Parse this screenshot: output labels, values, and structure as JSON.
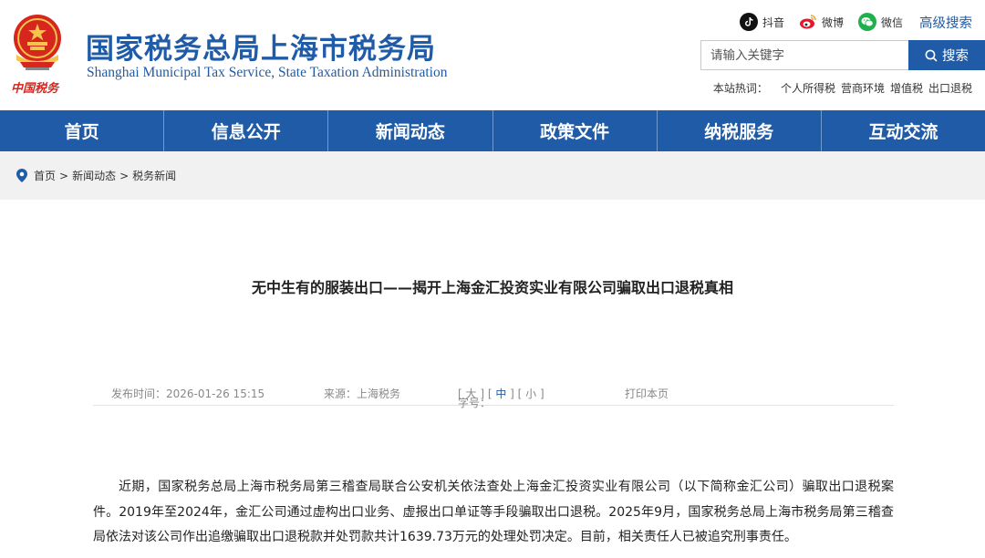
{
  "header": {
    "title_cn": "国家税务总局上海市税务局",
    "title_en": "Shanghai Municipal Tax Service, State Taxation Administration",
    "logo_caption": "中国税务",
    "social": [
      {
        "label": "抖音",
        "icon": "douyin-icon"
      },
      {
        "label": "微博",
        "icon": "weibo-icon"
      },
      {
        "label": "微信",
        "icon": "wechat-icon"
      }
    ],
    "advanced_search": "高级搜索",
    "search_placeholder": "请输入关键字",
    "search_button": "搜索",
    "hot_label": "本站热词：",
    "hot_words": [
      "个人所得税",
      "营商环境",
      "增值税",
      "出口退税"
    ]
  },
  "nav": {
    "items": [
      "首页",
      "信息公开",
      "新闻动态",
      "政策文件",
      "纳税服务",
      "互动交流"
    ]
  },
  "breadcrumb": {
    "items": [
      "首页",
      "新闻动态",
      "税务新闻"
    ],
    "separator": ">"
  },
  "article": {
    "title": "无中生有的服装出口——揭开上海金汇投资实业有限公司骗取出口退税真相",
    "publish_time": "发布时间：2026-01-26 15:15",
    "source": "来源：上海税务",
    "font_label": "字号：",
    "font_sizes": [
      "大",
      "中",
      "小"
    ],
    "print": "打印本页",
    "body": "近期，国家税务总局上海市税务局第三稽查局联合公安机关依法查处上海金汇投资实业有限公司（以下简称金汇公司）骗取出口退税案件。2019年至2024年，金汇公司通过虚构出口业务、虚报出口单证等手段骗取出口退税。2025年9月，国家税务总局上海市税务局第三稽查局依法对该公司作出追缴骗取出口退税款并处罚款共计1639.73万元的处理处罚决定。目前，相关责任人已被追究刑事责任。"
  },
  "colors": {
    "brand_blue": "#1f5ba6",
    "logo_red": "#d7261e",
    "wechat_green": "#20b04b"
  }
}
